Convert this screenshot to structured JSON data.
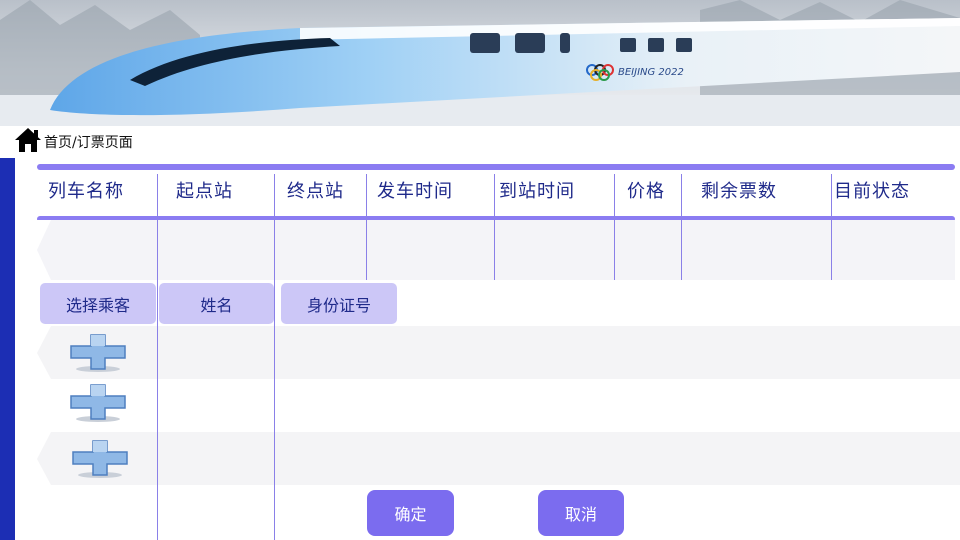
{
  "breadcrumb": {
    "icon": "home-icon",
    "text": "首页/订票页面"
  },
  "banner": {
    "description_icon": "train-banner",
    "logo_text": "BEIJING 2022"
  },
  "train_table": {
    "headers": [
      "列车名称",
      "起点站",
      "终点站",
      "发车时间",
      "到站时间",
      "价格",
      "剩余票数",
      "目前状态"
    ],
    "rows": []
  },
  "passenger_section": {
    "select_label": "选择乘客",
    "name_label": "姓名",
    "id_label": "身份证号",
    "add_icon": "plus-icon"
  },
  "actions": {
    "confirm_label": "确定",
    "cancel_label": "取消"
  },
  "colors": {
    "accent": "#7b6cef",
    "header_line": "#8b7cf2",
    "sidebar": "#1c2eb4",
    "header_text": "#1f2a8a",
    "pill": "#ccc7f7"
  }
}
